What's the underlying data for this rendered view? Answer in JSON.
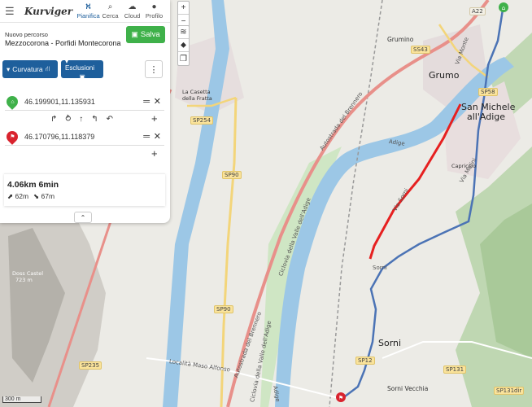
{
  "app": {
    "logo": "Kurviger",
    "nav": [
      {
        "id": "plan",
        "label": "Pianifica",
        "icon": "route-icon",
        "glyph": "⛕",
        "active": true
      },
      {
        "id": "search",
        "label": "Cerca",
        "icon": "search-icon",
        "glyph": "⌕",
        "active": false
      },
      {
        "id": "cloud",
        "label": "Cloud",
        "icon": "cloud-icon",
        "glyph": "☁",
        "active": false
      },
      {
        "id": "profile",
        "label": "Profilo",
        "icon": "user-icon",
        "glyph": "●",
        "active": false
      }
    ]
  },
  "route": {
    "header_label": "Nuovo percorso",
    "name": "Mezzocorona - Porfidi Montecorona",
    "save_label": "Salva"
  },
  "options": {
    "curvature_label": "Curvatura",
    "exclusions_label": "Esclusioni"
  },
  "waypoints": [
    {
      "coord": "46.199901,11.135931",
      "type": "start",
      "color": "#3fb14a",
      "icon": "home-icon"
    },
    {
      "coord": "46.170796,11.118379",
      "type": "end",
      "color": "#d9232e",
      "icon": "flag-icon"
    }
  ],
  "turn_icons": [
    "turn-right-icon",
    "roundabout-icon",
    "straight-icon",
    "turn-left-icon",
    "u-turn-icon"
  ],
  "summary": {
    "distance_time": "4.06km  6min",
    "ascent": "62m",
    "descent": "67m"
  },
  "map": {
    "scale_label": "300 m",
    "labels": {
      "grumino": "Grumino",
      "grumo": "Grumo",
      "san_michele": "San Michele",
      "all_adige": "all'Adige",
      "sorni": "Sorni",
      "sorni_vecchia": "Sorni Vecchia",
      "capriccio": "Capriccio",
      "la_casetta": "La Casetta",
      "della_fratta": "della Fratta",
      "doss_castel": "Doss Castel",
      "doss_castel_alt": "723 m",
      "maso_alfonso": "Località Maso Alfonso",
      "via_monte": "Via Monte",
      "via_molini": "Via Molini",
      "via_sorni": "Via Sorni",
      "sorni_road": "Sorni",
      "adige": "Adige",
      "autostrada": "Autostrada del Brennero",
      "ciclovia": "Ciclovia della Valle dell'Adige"
    },
    "roads": [
      "A22",
      "SS43",
      "SP58",
      "SP254",
      "SP90",
      "SP235",
      "SP131",
      "SP131dir",
      "SP12"
    ],
    "colors": {
      "river": "#9cc7e6",
      "route": "#4b73b5",
      "curvy": "#e62020",
      "highway": "#e8908a",
      "green": "#cfe6c4"
    }
  }
}
